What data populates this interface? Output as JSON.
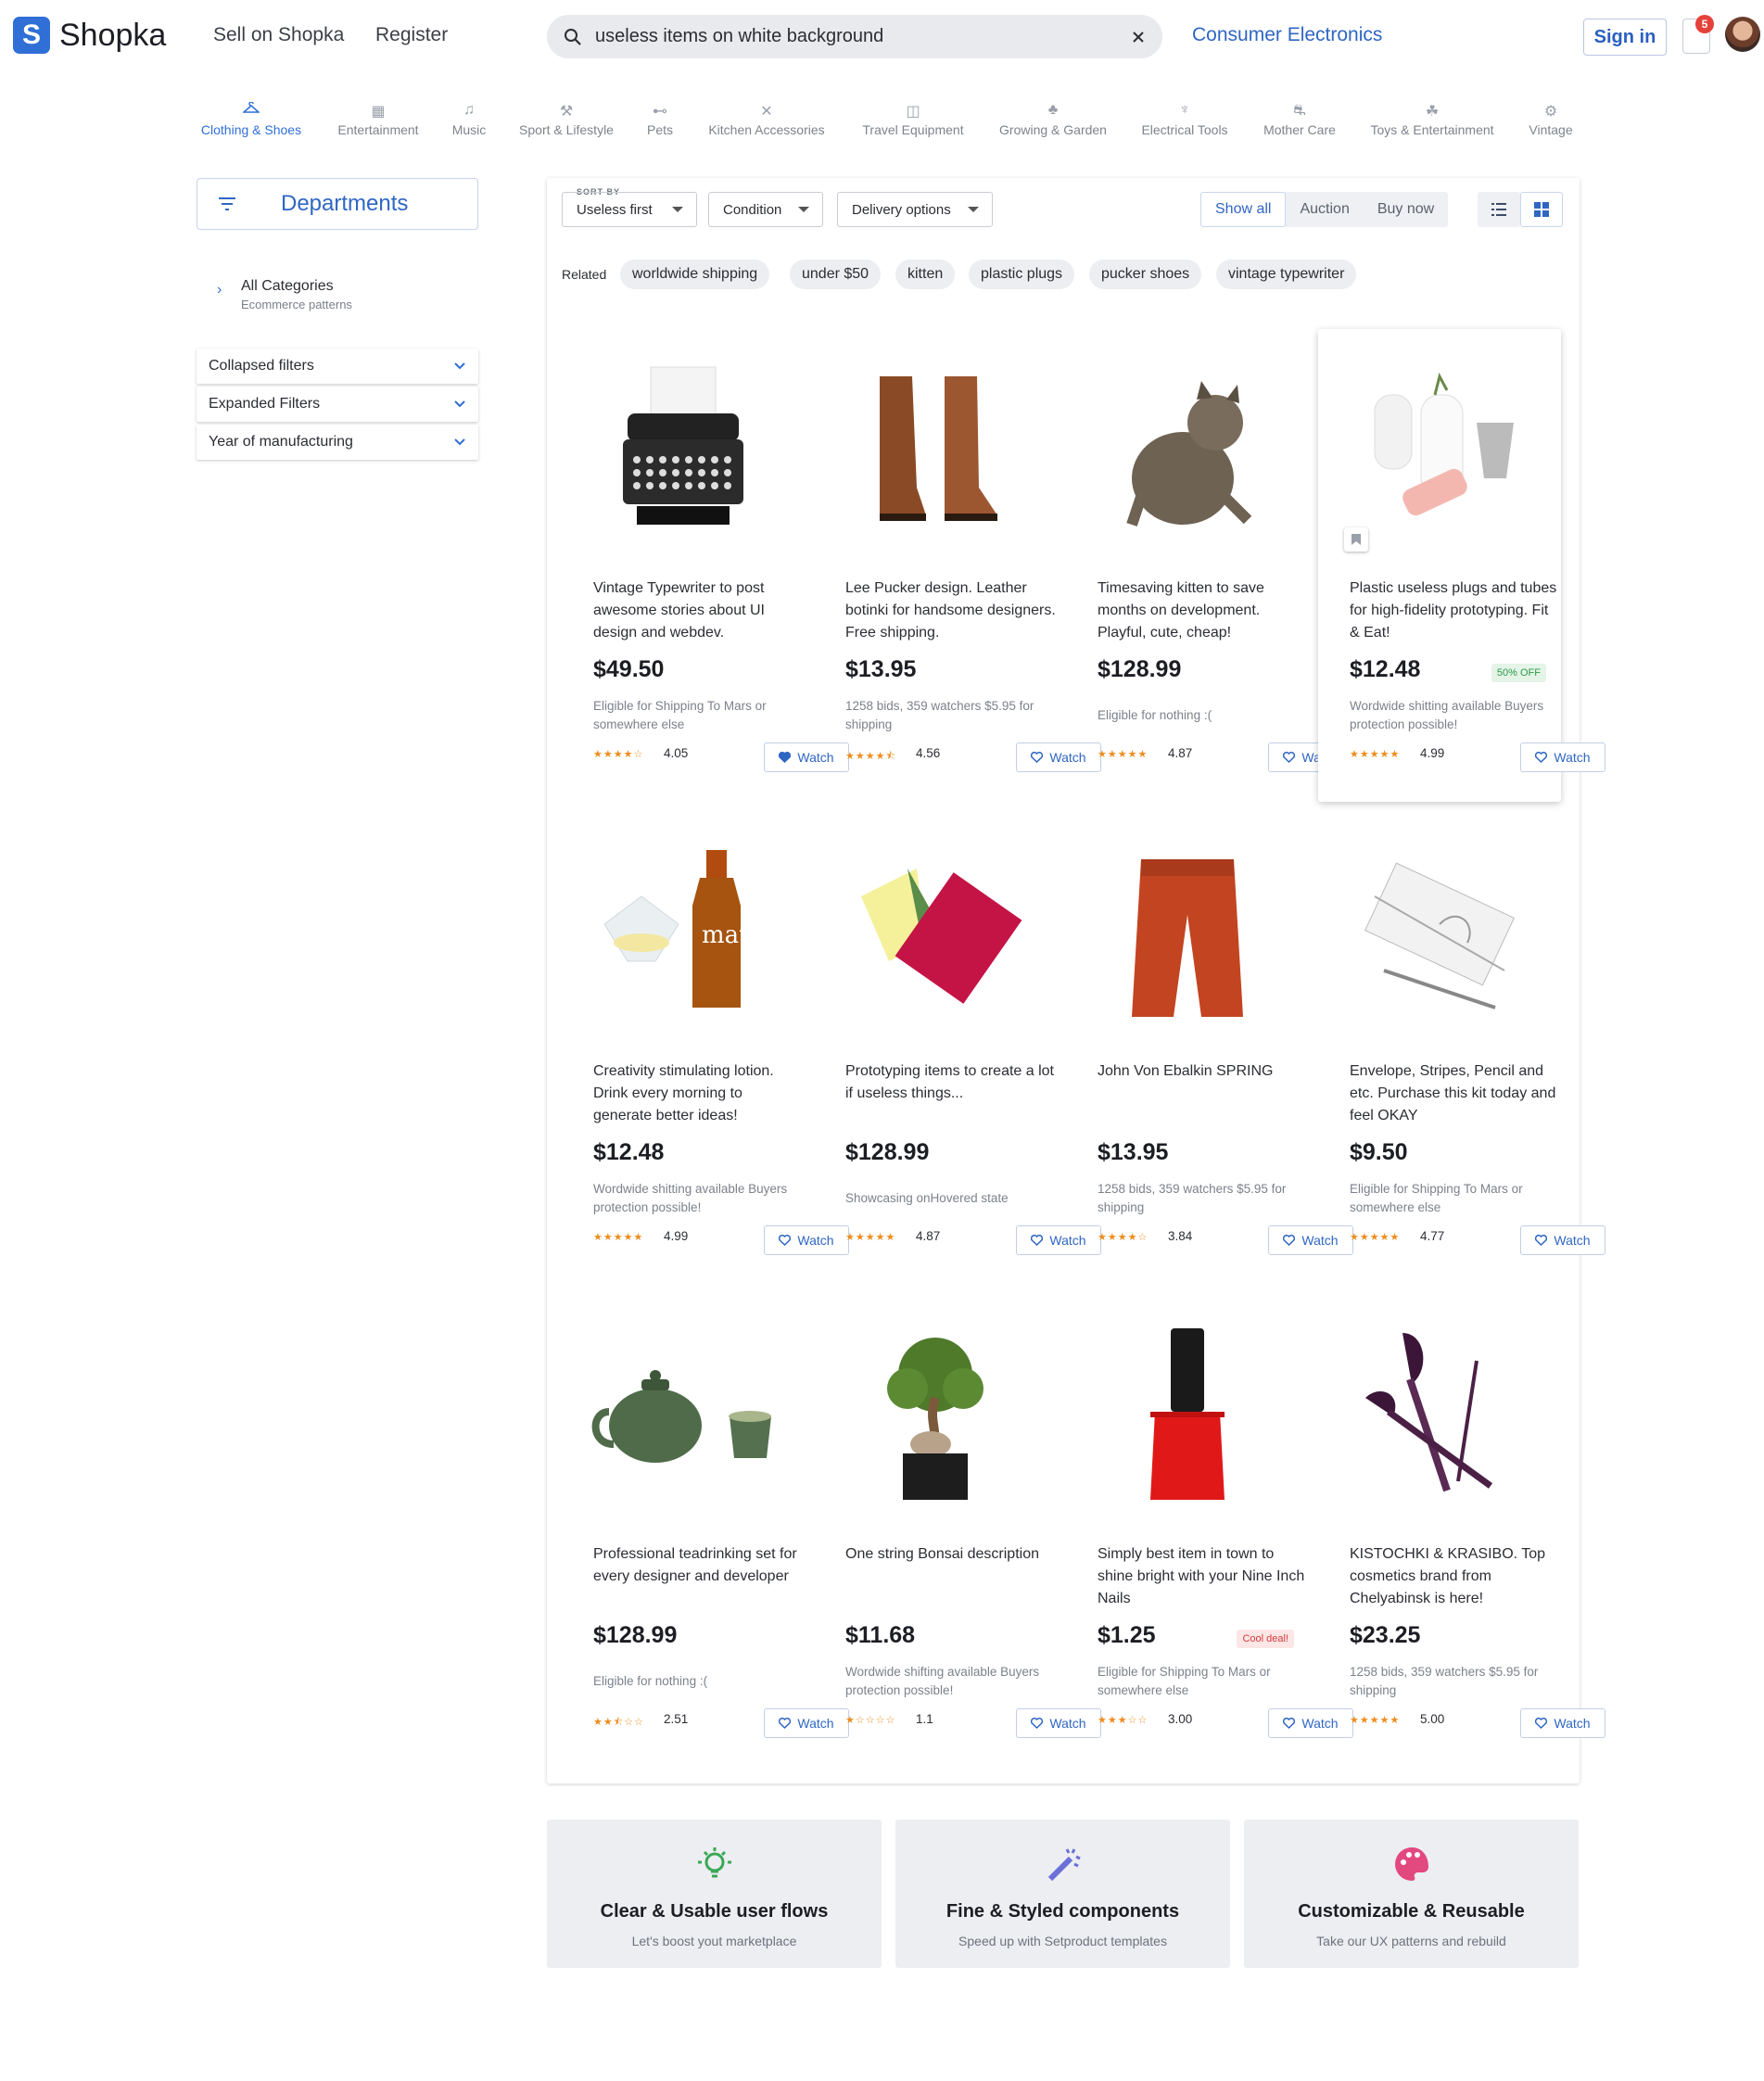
{
  "header": {
    "logo_letter": "S",
    "logo_text": "Shopka",
    "nav": [
      "Sell on Shopka",
      "Register"
    ],
    "search_query": "useless items on white background",
    "category_link": "Consumer Electronics",
    "sign_in": "Sign in",
    "notifications_count": "5"
  },
  "categories": [
    {
      "label": "Clothing & Shoes",
      "icon": "hanger-icon",
      "active": true
    },
    {
      "label": "Entertainment",
      "icon": "film-icon"
    },
    {
      "label": "Music",
      "icon": "music-note-icon"
    },
    {
      "label": "Sport & Lifestyle",
      "icon": "dumbbell-icon"
    },
    {
      "label": "Pets",
      "icon": "bone-icon"
    },
    {
      "label": "Kitchen Accessories",
      "icon": "cutlery-icon"
    },
    {
      "label": "Travel Equipment",
      "icon": "luggage-icon"
    },
    {
      "label": "Growing & Garden",
      "icon": "plant-icon"
    },
    {
      "label": "Electrical Tools",
      "icon": "plug-icon"
    },
    {
      "label": "Mother Care",
      "icon": "stroller-icon"
    },
    {
      "label": "Toys & Entertainment",
      "icon": "toy-icon"
    },
    {
      "label": "Vintage",
      "icon": "gear-icon"
    }
  ],
  "sidebar": {
    "departments": "Departments",
    "all_categories": "All Categories",
    "all_categories_sub": "Ecommerce patterns",
    "filters": [
      "Collapsed filters",
      "Expanded Filters",
      "Year of manufacturing"
    ]
  },
  "toolbar": {
    "sort_by_label": "SORT BY",
    "sort_value": "Useless first",
    "condition": "Condition",
    "delivery": "Delivery options",
    "tabs": [
      "Show all",
      "Auction",
      "Buy now"
    ],
    "active_tab": "Show all"
  },
  "related": {
    "label": "Related",
    "chips": [
      "worldwide shipping",
      "under $50",
      "kitten",
      "plastic plugs",
      "pucker shoes",
      "vintage typewriter"
    ]
  },
  "watch_label": "Watch",
  "products": [
    {
      "desc": "Vintage Typewriter to post awesome stories about UI design and webdev.",
      "price": "$49.50",
      "ship": "Eligible for Shipping To Mars or somewhere else",
      "rating": "4.05",
      "stars": 4,
      "watched": true,
      "image": "typewriter"
    },
    {
      "desc": "Lee Pucker design. Leather botinki for handsome designers. Free shipping.",
      "price": "$13.95",
      "ship": "1258 bids, 359 watchers $5.95 for shipping",
      "rating": "4.56",
      "stars": 4.5,
      "image": "boots"
    },
    {
      "desc": "Timesaving kitten to save months on development. Playful, cute, cheap!",
      "price": "$128.99",
      "ship": "Eligible for nothing :(",
      "rating": "4.87",
      "stars": 5,
      "image": "kitten"
    },
    {
      "desc": "Plastic useless plugs and tubes for high-fidelity prototyping. Fit & Eat!",
      "price": "$12.48",
      "badge": "50% OFF",
      "ship": "Wordwide shitting available Buyers protection possible!",
      "rating": "4.99",
      "stars": 5,
      "highlight": true,
      "image": "vases"
    },
    {
      "desc": "Creativity stimulating lotion. Drink every morning to generate better ideas!",
      "price": "$12.48",
      "ship": "Wordwide shitting available Buyers protection possible!",
      "rating": "4.99",
      "stars": 5,
      "image": "bottle"
    },
    {
      "desc": "Prototyping items to create a lot if useless things...",
      "price": "$128.99",
      "ship": "Showcasing onHovered state",
      "rating": "4.87",
      "stars": 5,
      "image": "notebook"
    },
    {
      "desc": "John Von Ebalkin SPRING",
      "price": "$13.95",
      "ship": "1258 bids, 359 watchers $5.95 for shipping",
      "rating": "3.84",
      "stars": 4,
      "image": "pants"
    },
    {
      "desc": "Envelope, Stripes, Pencil and etc. Purchase this kit today and feel OKAY",
      "price": "$9.50",
      "ship": "Eligible for Shipping To Mars or somewhere else",
      "rating": "4.77",
      "stars": 5,
      "image": "envelope"
    },
    {
      "desc": "Professional teadrinking set for every designer and developer",
      "price": "$128.99",
      "ship": "Eligible for nothing :(",
      "rating": "2.51",
      "stars": 2.5,
      "image": "teapot"
    },
    {
      "desc": "One string Bonsai description",
      "price": "$11.68",
      "ship": "Wordwide shifting available Buyers protection possible!",
      "rating": "1.1",
      "stars": 1,
      "image": "bonsai"
    },
    {
      "desc": "Simply best item in town to shine bright with your Nine Inch Nails",
      "price": "$1.25",
      "badge": "Cool deal!",
      "badge_color": "red",
      "ship": "Eligible for Shipping To Mars or somewhere else",
      "rating": "3.00",
      "stars": 3,
      "image": "nailpolish"
    },
    {
      "desc": "KISTOCHKI & KRASIBO. Top cosmetics brand from Chelyabinsk is here!",
      "price": "$23.25",
      "ship": "1258 bids, 359 watchers $5.95 for shipping",
      "rating": "5.00",
      "stars": 5,
      "image": "brushes"
    }
  ],
  "features": [
    {
      "title": "Clear & Usable user flows",
      "sub": "Let's boost yout marketplace",
      "icon": "lightbulb-icon",
      "color": "#3aa757"
    },
    {
      "title": "Fine & Styled components",
      "sub": "Speed up with Setproduct templates",
      "icon": "magic-wand-icon",
      "color": "#6b6fd8"
    },
    {
      "title": "Customizable & Reusable",
      "sub": "Take our UX patterns and rebuild",
      "icon": "palette-icon",
      "color": "#e2497f"
    }
  ]
}
